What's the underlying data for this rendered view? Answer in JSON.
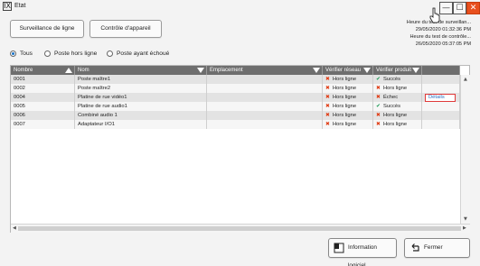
{
  "window": {
    "title": "Etat",
    "app_icon": "IX",
    "min_glyph": "—",
    "max_glyph": "☐",
    "close_glyph": "✕"
  },
  "toolbar": {
    "line_monitoring_label": "Surveillance de ligne",
    "device_check_label": "Contrôle d'appareil"
  },
  "test_info": {
    "monitoring_label": "Heure du test de surveillan...",
    "monitoring_time": "29/05/2020 01:32:36 PM",
    "device_label": "Heure du test de contrôle...",
    "device_time": "26/05/2020 05:37:05 PM"
  },
  "filters": {
    "selected": "Tous",
    "options": [
      "Tous",
      "Poste hors ligne",
      "Poste ayant échoué"
    ]
  },
  "table": {
    "columns": [
      "Nombre",
      "Nom",
      "Emplacement",
      "Vérifier réseau",
      "Vérifier produit",
      ""
    ],
    "rows": [
      {
        "number": "0001",
        "name": "Poste maître1",
        "location": "",
        "network": "Hors ligne",
        "network_status": "x",
        "product": "Succès",
        "product_status": "ok"
      },
      {
        "number": "0002",
        "name": "Poste maître2",
        "location": "",
        "network": "Hors ligne",
        "network_status": "x",
        "product": "Hors ligne",
        "product_status": "x"
      },
      {
        "number": "0004",
        "name": "Platine de rue vidéo1",
        "location": "",
        "network": "Hors ligne",
        "network_status": "x",
        "product": "Échec",
        "product_status": "x"
      },
      {
        "number": "0005",
        "name": "Platine de rue audio1",
        "location": "",
        "network": "Hors ligne",
        "network_status": "x",
        "product": "Succès",
        "product_status": "ok"
      },
      {
        "number": "0006",
        "name": "Combiné audio 1",
        "location": "",
        "network": "Hors ligne",
        "network_status": "x",
        "product": "Hors ligne",
        "product_status": "x"
      },
      {
        "number": "0007",
        "name": "Adaptateur I/O1",
        "location": "",
        "network": "Hors ligne",
        "network_status": "x",
        "product": "Hors ligne",
        "product_status": "x"
      }
    ],
    "detail_label": "Détails",
    "status_icons": {
      "x": "✖",
      "ok": "✔"
    }
  },
  "footer": {
    "software_info_label": "Information logiciel",
    "close_label": "Fermer"
  },
  "colors": {
    "accent_blue": "#1a73c8",
    "error_red": "#e03a12",
    "success_green": "#1f9a57",
    "header_gray": "#6e6e6e",
    "close_orange": "#e8501e"
  }
}
